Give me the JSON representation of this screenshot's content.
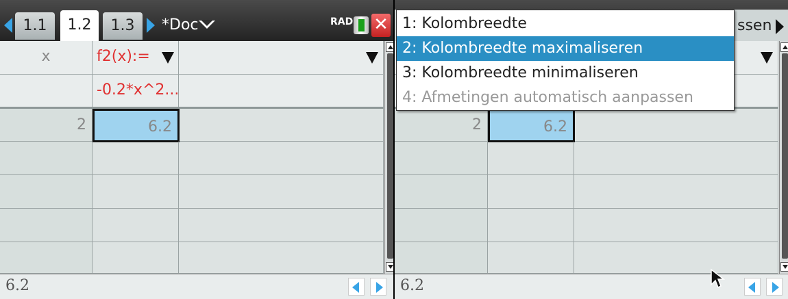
{
  "left": {
    "tabs": [
      "1.1",
      "1.2",
      "1.3"
    ],
    "active_tab": "1.2",
    "doc_title": "*Doc",
    "mode": "RAD",
    "close_symbol": "✕",
    "columns": [
      {
        "name": "x",
        "formula": ""
      },
      {
        "name": "f2(x):=",
        "formula": "-0.2*x^2..."
      }
    ],
    "rows": [
      {
        "x": "2",
        "f2": "6.2"
      }
    ],
    "entry_value": "6.2"
  },
  "right": {
    "menu_overflow_title": "ssen",
    "rows": [
      {
        "x": "2",
        "f2": "6.2"
      }
    ],
    "entry_value": "6.2"
  },
  "context_menu": {
    "items": [
      {
        "num": "1",
        "label": "Kolombreedte",
        "state": "normal"
      },
      {
        "num": "2",
        "label": "Kolombreedte maximaliseren",
        "state": "highlighted"
      },
      {
        "num": "3",
        "label": "Kolombreedte minimaliseren",
        "state": "normal"
      },
      {
        "num": "4",
        "label": "Afmetingen automatisch aanpassen",
        "state": "disabled"
      }
    ]
  },
  "colors": {
    "tab_arrow": "#38a4e6",
    "formula_red": "#e03030",
    "selection": "#9fd3ef",
    "menu_highlight": "#2a8fc4"
  }
}
